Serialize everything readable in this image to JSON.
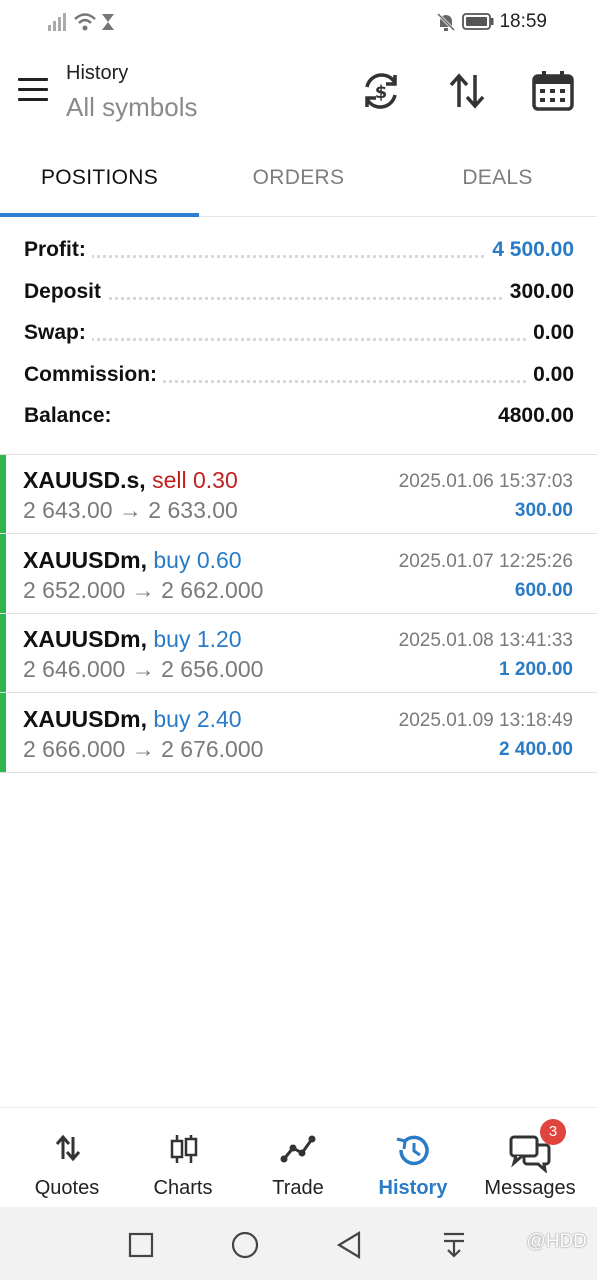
{
  "status_bar": {
    "time": "18:59"
  },
  "header": {
    "title": "History",
    "subtitle": "All symbols"
  },
  "tabs": [
    {
      "label": "POSITIONS",
      "active": true
    },
    {
      "label": "ORDERS",
      "active": false
    },
    {
      "label": "DEALS",
      "active": false
    }
  ],
  "summary": {
    "profit": {
      "label": "Profit:",
      "value": "4 500.00"
    },
    "deposit": {
      "label": "Deposit",
      "value": "300.00"
    },
    "swap": {
      "label": "Swap:",
      "value": "0.00"
    },
    "commission": {
      "label": "Commission:",
      "value": "0.00"
    },
    "balance": {
      "label": "Balance:",
      "value": "4800.00"
    }
  },
  "positions": [
    {
      "symbol": "XAUUSD.s,",
      "side": "sell 0.30",
      "prices": "2 643.00 → 2 633.00",
      "datetime": "2025.01.06 15:37:03",
      "profit": "300.00"
    },
    {
      "symbol": "XAUUSDm,",
      "side": "buy 0.60",
      "prices": "2 652.000 → 2 662.000",
      "datetime": "2025.01.07 12:25:26",
      "profit": "600.00"
    },
    {
      "symbol": "XAUUSDm,",
      "side": "buy 1.20",
      "prices": "2 646.000 → 2 656.000",
      "datetime": "2025.01.08 13:41:33",
      "profit": "1 200.00"
    },
    {
      "symbol": "XAUUSDm,",
      "side": "buy 2.40",
      "prices": "2 666.000 → 2 676.000",
      "datetime": "2025.01.09 13:18:49",
      "profit": "2 400.00"
    }
  ],
  "bottom_nav": [
    {
      "label": "Quotes",
      "icon": "sort-arrows-icon"
    },
    {
      "label": "Charts",
      "icon": "candlestick-icon"
    },
    {
      "label": "Trade",
      "icon": "trend-line-icon"
    },
    {
      "label": "History",
      "icon": "history-clock-icon",
      "active": true
    },
    {
      "label": "Messages",
      "icon": "chat-bubbles-icon",
      "badge": "3"
    }
  ],
  "watermark": "@HDD",
  "colors": {
    "accent": "#2a7bc6",
    "sell": "#c2201f",
    "positions_bar": "#2fb54b",
    "badge": "#e0443e"
  }
}
